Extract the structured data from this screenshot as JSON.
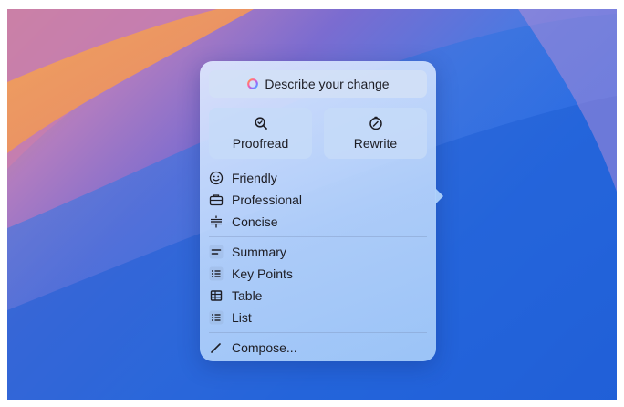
{
  "panel": {
    "describe_label": "Describe your change",
    "actions": [
      {
        "label": "Proofread",
        "icon": "magnifier-check-icon"
      },
      {
        "label": "Rewrite",
        "icon": "rewrite-dial-icon"
      }
    ],
    "tone_items": [
      {
        "label": "Friendly",
        "icon": "smiley-icon"
      },
      {
        "label": "Professional",
        "icon": "briefcase-icon"
      },
      {
        "label": "Concise",
        "icon": "divide-icon"
      }
    ],
    "format_items": [
      {
        "label": "Summary",
        "icon": "summary-icon"
      },
      {
        "label": "Key Points",
        "icon": "bullet-list-icon"
      },
      {
        "label": "Table",
        "icon": "table-icon"
      },
      {
        "label": "List",
        "icon": "numbered-list-icon"
      }
    ],
    "compose_label": "Compose..."
  }
}
